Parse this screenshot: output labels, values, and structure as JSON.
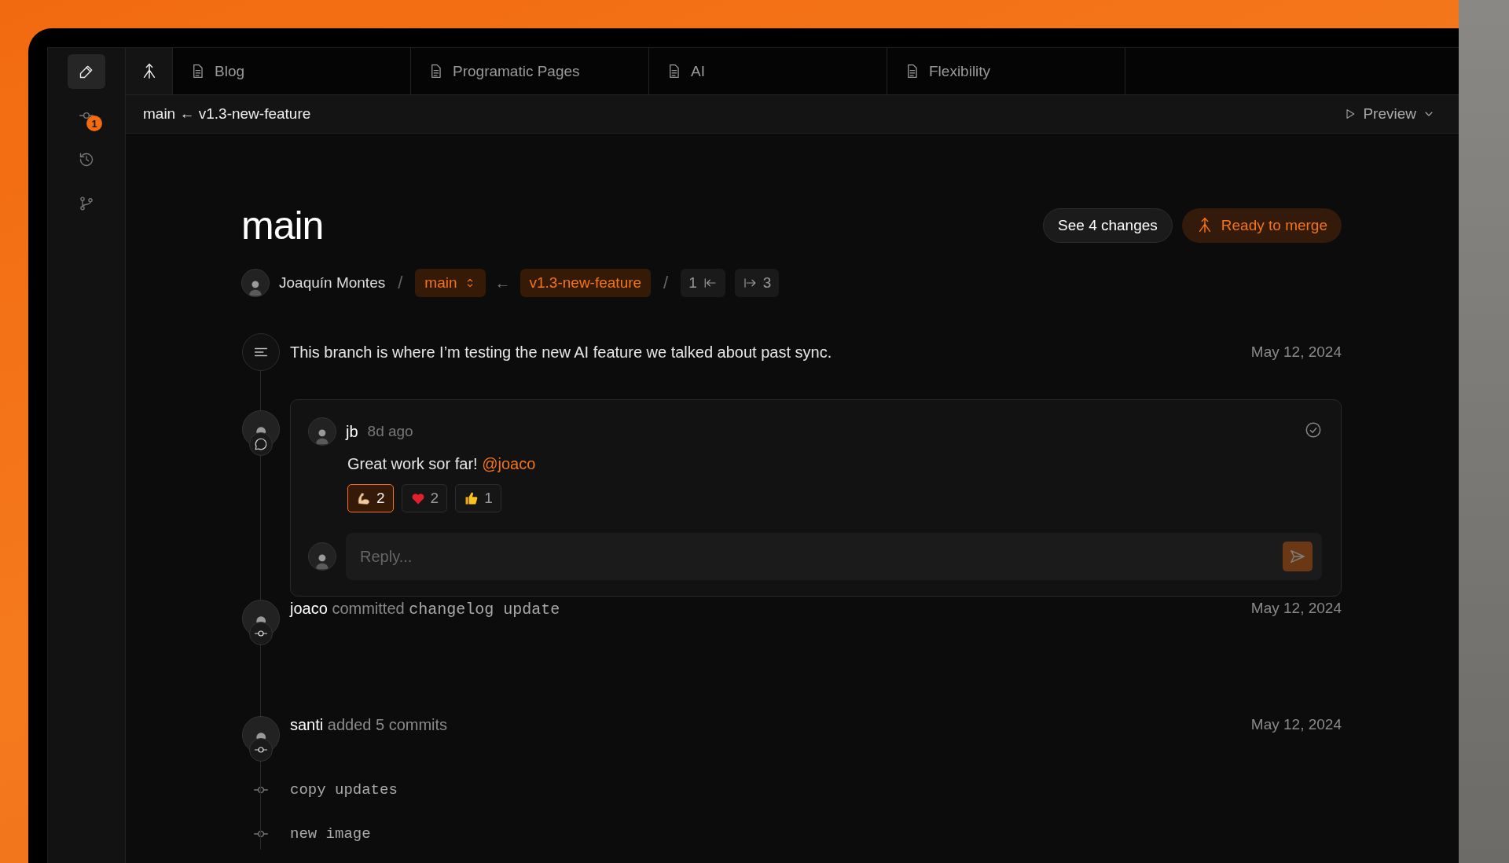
{
  "sidebar": {
    "items": [
      {
        "kind": "edit",
        "selected": true
      },
      {
        "kind": "commit",
        "selected": false,
        "badge": "1"
      },
      {
        "kind": "history",
        "selected": false
      },
      {
        "kind": "branch",
        "selected": false
      }
    ]
  },
  "tabs": [
    {
      "kind": "merge",
      "selected": true
    },
    {
      "kind": "page",
      "label": "Blog",
      "selected": false
    },
    {
      "kind": "page",
      "label": "Programatic Pages",
      "selected": false
    },
    {
      "kind": "page",
      "label": "AI",
      "selected": false
    },
    {
      "kind": "page",
      "label": "Flexibility",
      "selected": false
    }
  ],
  "branch_bar": {
    "path": "main ← v1.3-new-feature",
    "preview": "Preview"
  },
  "header": {
    "title": "main",
    "see_changes": "See 4 changes",
    "merge": "Ready to merge"
  },
  "meta": {
    "author": "Joaquín Montes",
    "separators": [
      "/",
      "/"
    ],
    "base": "main",
    "arrow": "←",
    "head": "v1.3-new-feature",
    "behind": "1",
    "ahead": "3"
  },
  "timeline": [
    {
      "kind": "description",
      "text": "This branch is where I’m testing the new AI feature we talked about past sync.",
      "date": "May 12, 2024"
    },
    {
      "kind": "comment",
      "author": "jb",
      "time": "8d ago",
      "text": "Great work sor far!",
      "mention": "@joaco",
      "resolved": true,
      "reactions": [
        {
          "kind": "muscle",
          "count": "2",
          "selected": true
        },
        {
          "kind": "heart",
          "count": "2",
          "selected": false
        },
        {
          "kind": "thumbs",
          "count": "1",
          "selected": false
        }
      ],
      "reply": {
        "placeholder": "Reply..."
      }
    },
    {
      "kind": "commit",
      "author": "joaco",
      "action": "committed",
      "message": "changelog update",
      "date": "May 12, 2024"
    },
    {
      "kind": "commits",
      "author": "santi",
      "action": "added 5 commits",
      "date": "May 12, 2024",
      "commits": [
        "copy updates",
        "new image"
      ]
    }
  ]
}
